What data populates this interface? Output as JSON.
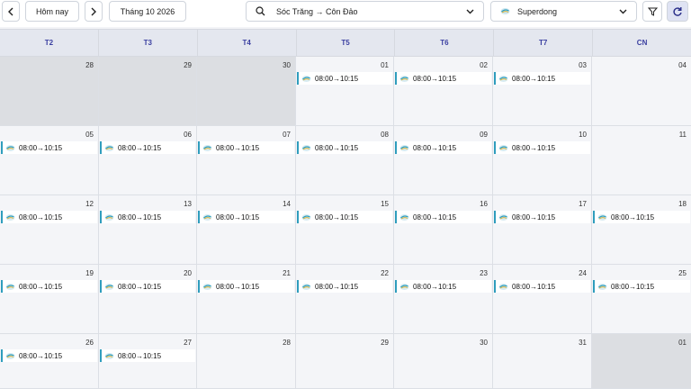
{
  "toolbar": {
    "today_label": "Hôm nay",
    "month_label": "Tháng 10 2026",
    "route_value": "Sóc Trăng → Côn Đảo",
    "operator_value": "Superdong"
  },
  "colors": {
    "accent": "#3a3fa0",
    "event_bar": "#2f9dbd",
    "muted_cell": "#dcdee2",
    "cell": "#f4f5f8"
  },
  "weekdays": [
    "T2",
    "T3",
    "T4",
    "T5",
    "T6",
    "T7",
    "CN"
  ],
  "weeks": [
    [
      {
        "day": "28",
        "muted": true,
        "event": ""
      },
      {
        "day": "29",
        "muted": true,
        "event": ""
      },
      {
        "day": "30",
        "muted": true,
        "event": ""
      },
      {
        "day": "01",
        "muted": false,
        "event": "08:00→10:15"
      },
      {
        "day": "02",
        "muted": false,
        "event": "08:00→10:15"
      },
      {
        "day": "03",
        "muted": false,
        "event": "08:00→10:15"
      },
      {
        "day": "04",
        "muted": false,
        "event": ""
      }
    ],
    [
      {
        "day": "05",
        "muted": false,
        "event": "08:00→10:15"
      },
      {
        "day": "06",
        "muted": false,
        "event": "08:00→10:15"
      },
      {
        "day": "07",
        "muted": false,
        "event": "08:00→10:15"
      },
      {
        "day": "08",
        "muted": false,
        "event": "08:00→10:15"
      },
      {
        "day": "09",
        "muted": false,
        "event": "08:00→10:15"
      },
      {
        "day": "10",
        "muted": false,
        "event": "08:00→10:15"
      },
      {
        "day": "11",
        "muted": false,
        "event": ""
      }
    ],
    [
      {
        "day": "12",
        "muted": false,
        "event": "08:00→10:15"
      },
      {
        "day": "13",
        "muted": false,
        "event": "08:00→10:15"
      },
      {
        "day": "14",
        "muted": false,
        "event": "08:00→10:15"
      },
      {
        "day": "15",
        "muted": false,
        "event": "08:00→10:15"
      },
      {
        "day": "16",
        "muted": false,
        "event": "08:00→10:15"
      },
      {
        "day": "17",
        "muted": false,
        "event": "08:00→10:15"
      },
      {
        "day": "18",
        "muted": false,
        "event": "08:00→10:15"
      }
    ],
    [
      {
        "day": "19",
        "muted": false,
        "event": "08:00→10:15"
      },
      {
        "day": "20",
        "muted": false,
        "event": "08:00→10:15"
      },
      {
        "day": "21",
        "muted": false,
        "event": "08:00→10:15"
      },
      {
        "day": "22",
        "muted": false,
        "event": "08:00→10:15"
      },
      {
        "day": "23",
        "muted": false,
        "event": "08:00→10:15"
      },
      {
        "day": "24",
        "muted": false,
        "event": "08:00→10:15"
      },
      {
        "day": "25",
        "muted": false,
        "event": "08:00→10:15"
      }
    ],
    [
      {
        "day": "26",
        "muted": false,
        "event": "08:00→10:15"
      },
      {
        "day": "27",
        "muted": false,
        "event": "08:00→10:15"
      },
      {
        "day": "28",
        "muted": false,
        "event": ""
      },
      {
        "day": "29",
        "muted": false,
        "event": ""
      },
      {
        "day": "30",
        "muted": false,
        "event": ""
      },
      {
        "day": "31",
        "muted": false,
        "event": ""
      },
      {
        "day": "01",
        "muted": true,
        "event": ""
      }
    ]
  ]
}
